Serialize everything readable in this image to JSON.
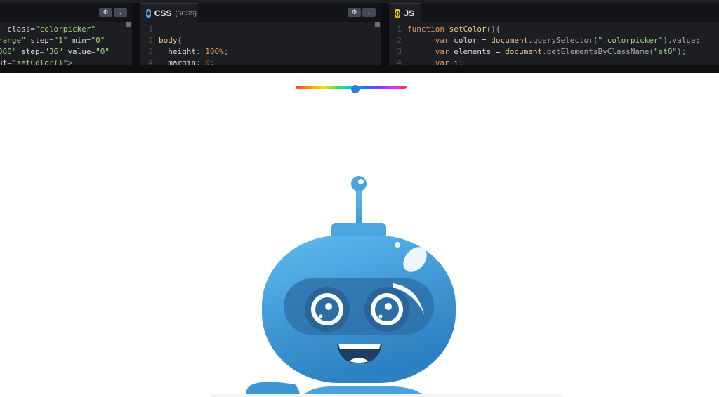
{
  "editor": {
    "html_pane": {
      "settings_icon": "gear-icon",
      "collapse_icon": "chevron-down-icon",
      "lines": [
        [
          {
            "t": "\" ",
            "c": "p"
          },
          {
            "t": "class",
            "c": "a"
          },
          {
            "t": "=",
            "c": "p"
          },
          {
            "t": "\"colorpicker\"",
            "c": "s"
          }
        ],
        [
          {
            "t": "range\"",
            "c": "s"
          },
          {
            "t": " step",
            "c": "a"
          },
          {
            "t": "=",
            "c": "p"
          },
          {
            "t": "\"1\"",
            "c": "s"
          },
          {
            "t": " min",
            "c": "a"
          },
          {
            "t": "=",
            "c": "p"
          },
          {
            "t": "\"0\"",
            "c": "s"
          }
        ],
        [
          {
            "t": "360\"",
            "c": "s"
          },
          {
            "t": " step",
            "c": "a"
          },
          {
            "t": "=",
            "c": "p"
          },
          {
            "t": "\"36\"",
            "c": "s"
          },
          {
            "t": " value",
            "c": "a"
          },
          {
            "t": "=",
            "c": "p"
          },
          {
            "t": "\"0\"",
            "c": "s"
          }
        ],
        [
          {
            "t": "ut",
            "c": "a"
          },
          {
            "t": "=",
            "c": "p"
          },
          {
            "t": "\"setColor()\"",
            "c": "s"
          },
          {
            "t": ">",
            "c": "p"
          }
        ]
      ]
    },
    "css_pane": {
      "tab_label": "CSS",
      "tab_sublabel": "(SCSS)",
      "tab_icon": "scss-icon",
      "settings_icon": "gear-icon",
      "collapse_icon": "chevron-down-icon",
      "lines": [
        {
          "num": "1",
          "parts": []
        },
        {
          "num": "2",
          "parts": [
            {
              "t": "body",
              "c": "f"
            },
            {
              "t": "{",
              "c": "p"
            }
          ]
        },
        {
          "num": "3",
          "parts": [
            {
              "t": "  height",
              "c": "a"
            },
            {
              "t": ": ",
              "c": "p"
            },
            {
              "t": "100%",
              "c": "n"
            },
            {
              "t": ";",
              "c": "p"
            }
          ]
        },
        {
          "num": "4",
          "parts": [
            {
              "t": "  margin",
              "c": "a"
            },
            {
              "t": ": ",
              "c": "p"
            },
            {
              "t": "0",
              "c": "n"
            },
            {
              "t": ";",
              "c": "p"
            }
          ]
        }
      ]
    },
    "js_pane": {
      "tab_label": "JS",
      "tab_icon": "js-icon",
      "lines": [
        {
          "num": "1",
          "parts": [
            {
              "t": "function ",
              "c": "k"
            },
            {
              "t": "setColor",
              "c": "f"
            },
            {
              "t": "(){",
              "c": "p"
            }
          ]
        },
        {
          "num": "2",
          "parts": [
            {
              "t": "      var ",
              "c": "k"
            },
            {
              "t": "color = ",
              "c": "a"
            },
            {
              "t": "document",
              "c": "v"
            },
            {
              "t": ".querySelector(",
              "c": "p"
            },
            {
              "t": "\".colorpicker\"",
              "c": "s"
            },
            {
              "t": ").value;",
              "c": "p"
            }
          ]
        },
        {
          "num": "3",
          "parts": [
            {
              "t": "      var ",
              "c": "k"
            },
            {
              "t": "elements = ",
              "c": "a"
            },
            {
              "t": "document",
              "c": "v"
            },
            {
              "t": ".getElementsByClassName(",
              "c": "p"
            },
            {
              "t": "\"st0\"",
              "c": "s"
            },
            {
              "t": ");",
              "c": "p"
            }
          ]
        },
        {
          "num": "4",
          "parts": [
            {
              "t": "      var ",
              "c": "k"
            },
            {
              "t": "i;",
              "c": "a"
            }
          ]
        }
      ]
    }
  },
  "preview": {
    "hue_slider": {
      "min": 0,
      "max": 360,
      "step": 36,
      "value_fraction": 0.54
    },
    "robot": {
      "name": "robot-illustration",
      "color": "#4aa3df"
    }
  }
}
